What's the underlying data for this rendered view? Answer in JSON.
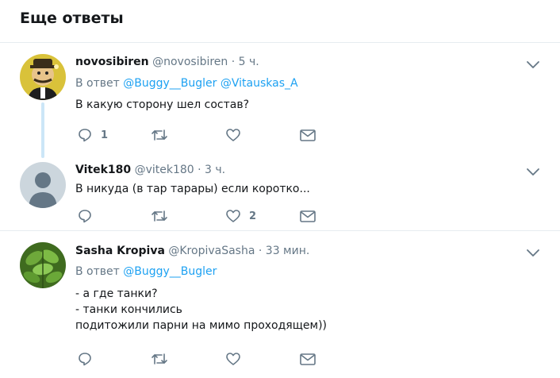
{
  "header": {
    "title": "Еще ответы"
  },
  "colors": {
    "link": "#1da1f2",
    "secondary_text": "#657786",
    "thread_line": "#cce6f7",
    "divider": "#e6ecf0"
  },
  "tweets": [
    {
      "name": "novosibiren",
      "handle": "@novosibiren",
      "dot": "·",
      "time": "5 ч.",
      "reply_prefix": "В ответ",
      "mentions": [
        "@Buggy__Bugler",
        "@Vitauskas_A"
      ],
      "lines": [
        "В какую сторону шел состав?"
      ],
      "reply_count": "1",
      "like_count": "",
      "avatar_icon": "cartoon-man-avatar"
    },
    {
      "name": "Vitek180",
      "handle": "@vitek180",
      "dot": "·",
      "time": "3 ч.",
      "lines": [
        "В никуда (в  тар тарары) если коротко..."
      ],
      "reply_count": "",
      "like_count": "2",
      "avatar_icon": "default-profile-avatar"
    },
    {
      "name": "Sasha Kropiva",
      "handle": "@KropivaSasha",
      "dot": "·",
      "time": "33 мин.",
      "reply_prefix": "В ответ",
      "mentions": [
        "@Buggy__Bugler"
      ],
      "lines": [
        "- а где танки?",
        "- танки кончились",
        "подитожили парни на мимо проходящем))"
      ],
      "reply_count": "",
      "like_count": "",
      "avatar_icon": "nettle-leaves-avatar"
    }
  ]
}
